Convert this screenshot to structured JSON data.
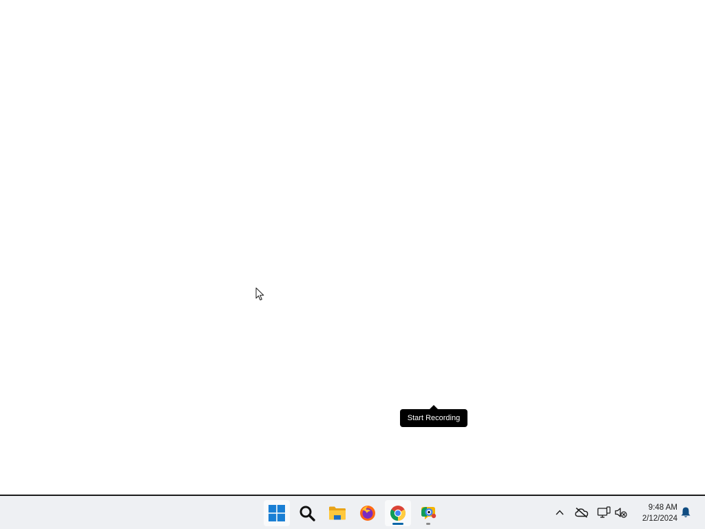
{
  "tooltip": {
    "text": "Start Recording"
  },
  "taskbar": {
    "apps": [
      {
        "name": "Start",
        "icon": "windows-start-icon",
        "state": "none"
      },
      {
        "name": "Search",
        "icon": "search-icon",
        "state": "none"
      },
      {
        "name": "File Explorer",
        "icon": "folder-icon",
        "state": "none"
      },
      {
        "name": "Firefox",
        "icon": "firefox-icon",
        "state": "none"
      },
      {
        "name": "Chrome",
        "icon": "chrome-icon",
        "state": "focused"
      },
      {
        "name": "Screen Recorder",
        "icon": "recorder-icon",
        "state": "open"
      }
    ],
    "tray": {
      "icons": [
        "chevron-up-icon",
        "cloud-offline-icon",
        "network-icon",
        "volume-muted-icon",
        "notification-bell-icon"
      ],
      "time": "9:48 AM",
      "date": "2/12/2024"
    }
  },
  "colors": {
    "taskbar_bg": "#eef0f3",
    "tooltip_bg": "#000000",
    "accent": "#0a66a8",
    "start_blue": "#1a7fd4",
    "bell_blue": "#0f4c81"
  }
}
